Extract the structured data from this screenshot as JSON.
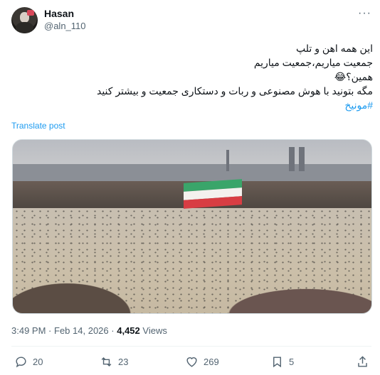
{
  "author": {
    "name": "Hasan",
    "handle": "@aln_110",
    "avatar_icon": "user-avatar"
  },
  "more_icon": "more-options-icon",
  "tweet": {
    "lines": [
      "این همه اهن و تلپ",
      "جمعیت میاریم،جمعیت میاریم",
      "همین؟😂",
      "مگه بتونید با هوش مصنوعی و ربات و دستکاری جمعیت و بیشتر کنید"
    ],
    "hashtag": "#مونیخ"
  },
  "translate_label": "Translate post",
  "media": {
    "flag_colors": [
      "#3aa56a",
      "#f4f1ee",
      "#d83d43"
    ]
  },
  "meta": {
    "time": "3:49 PM",
    "separator": "·",
    "date": "Feb 14, 2026",
    "views_count": "4,452",
    "views_label": "Views"
  },
  "actions": {
    "replies": "20",
    "reposts": "23",
    "likes": "269",
    "bookmarks": "5"
  },
  "colors": {
    "accent": "#1d9bf0",
    "text": "#0f1419",
    "secondary": "#536471"
  }
}
